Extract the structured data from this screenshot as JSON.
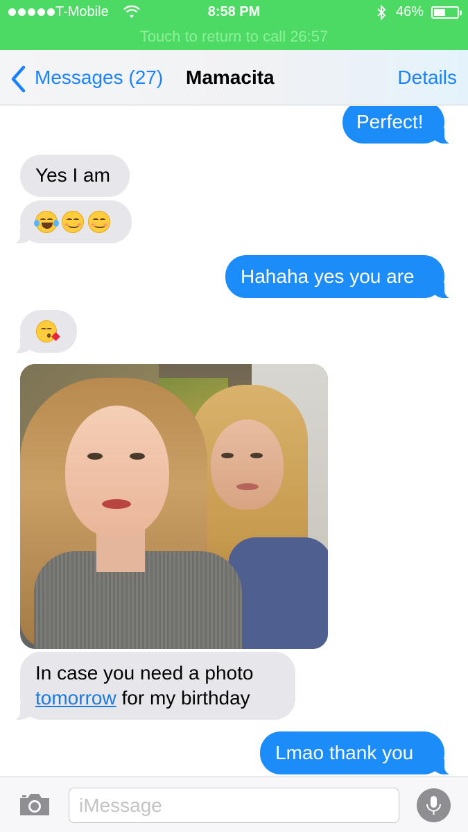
{
  "status_bar": {
    "carrier": "T-Mobile",
    "time": "8:58 PM",
    "battery": "46%",
    "call_banner": "Touch to return to call  26:57",
    "background_color": "#4cd964"
  },
  "nav": {
    "back_label": "Messages (27)",
    "title": "Mamacita",
    "details_label": "Details",
    "accent_color": "#1a82fb"
  },
  "messages": [
    {
      "direction": "outgoing",
      "text": "Perfect!"
    },
    {
      "direction": "incoming",
      "text": "Yes I am"
    },
    {
      "direction": "incoming",
      "emoji": [
        "face-with-tears-of-joy",
        "smiling-face",
        "smiling-face"
      ]
    },
    {
      "direction": "outgoing",
      "text": "Hahaha yes you are"
    },
    {
      "direction": "incoming",
      "emoji": [
        "face-blowing-a-kiss"
      ]
    },
    {
      "direction": "incoming",
      "attachment": "photo"
    },
    {
      "direction": "incoming",
      "text_before_link": "In case you need a photo",
      "link_text": "tomorrow",
      "text_after_link": "for my birthday"
    },
    {
      "direction": "outgoing",
      "text": "Lmao thank you"
    }
  ],
  "input_bar": {
    "placeholder": "iMessage",
    "value": ""
  },
  "colors": {
    "outgoing_bubble": "#1b8cf8",
    "incoming_bubble": "#e6e6eb"
  }
}
